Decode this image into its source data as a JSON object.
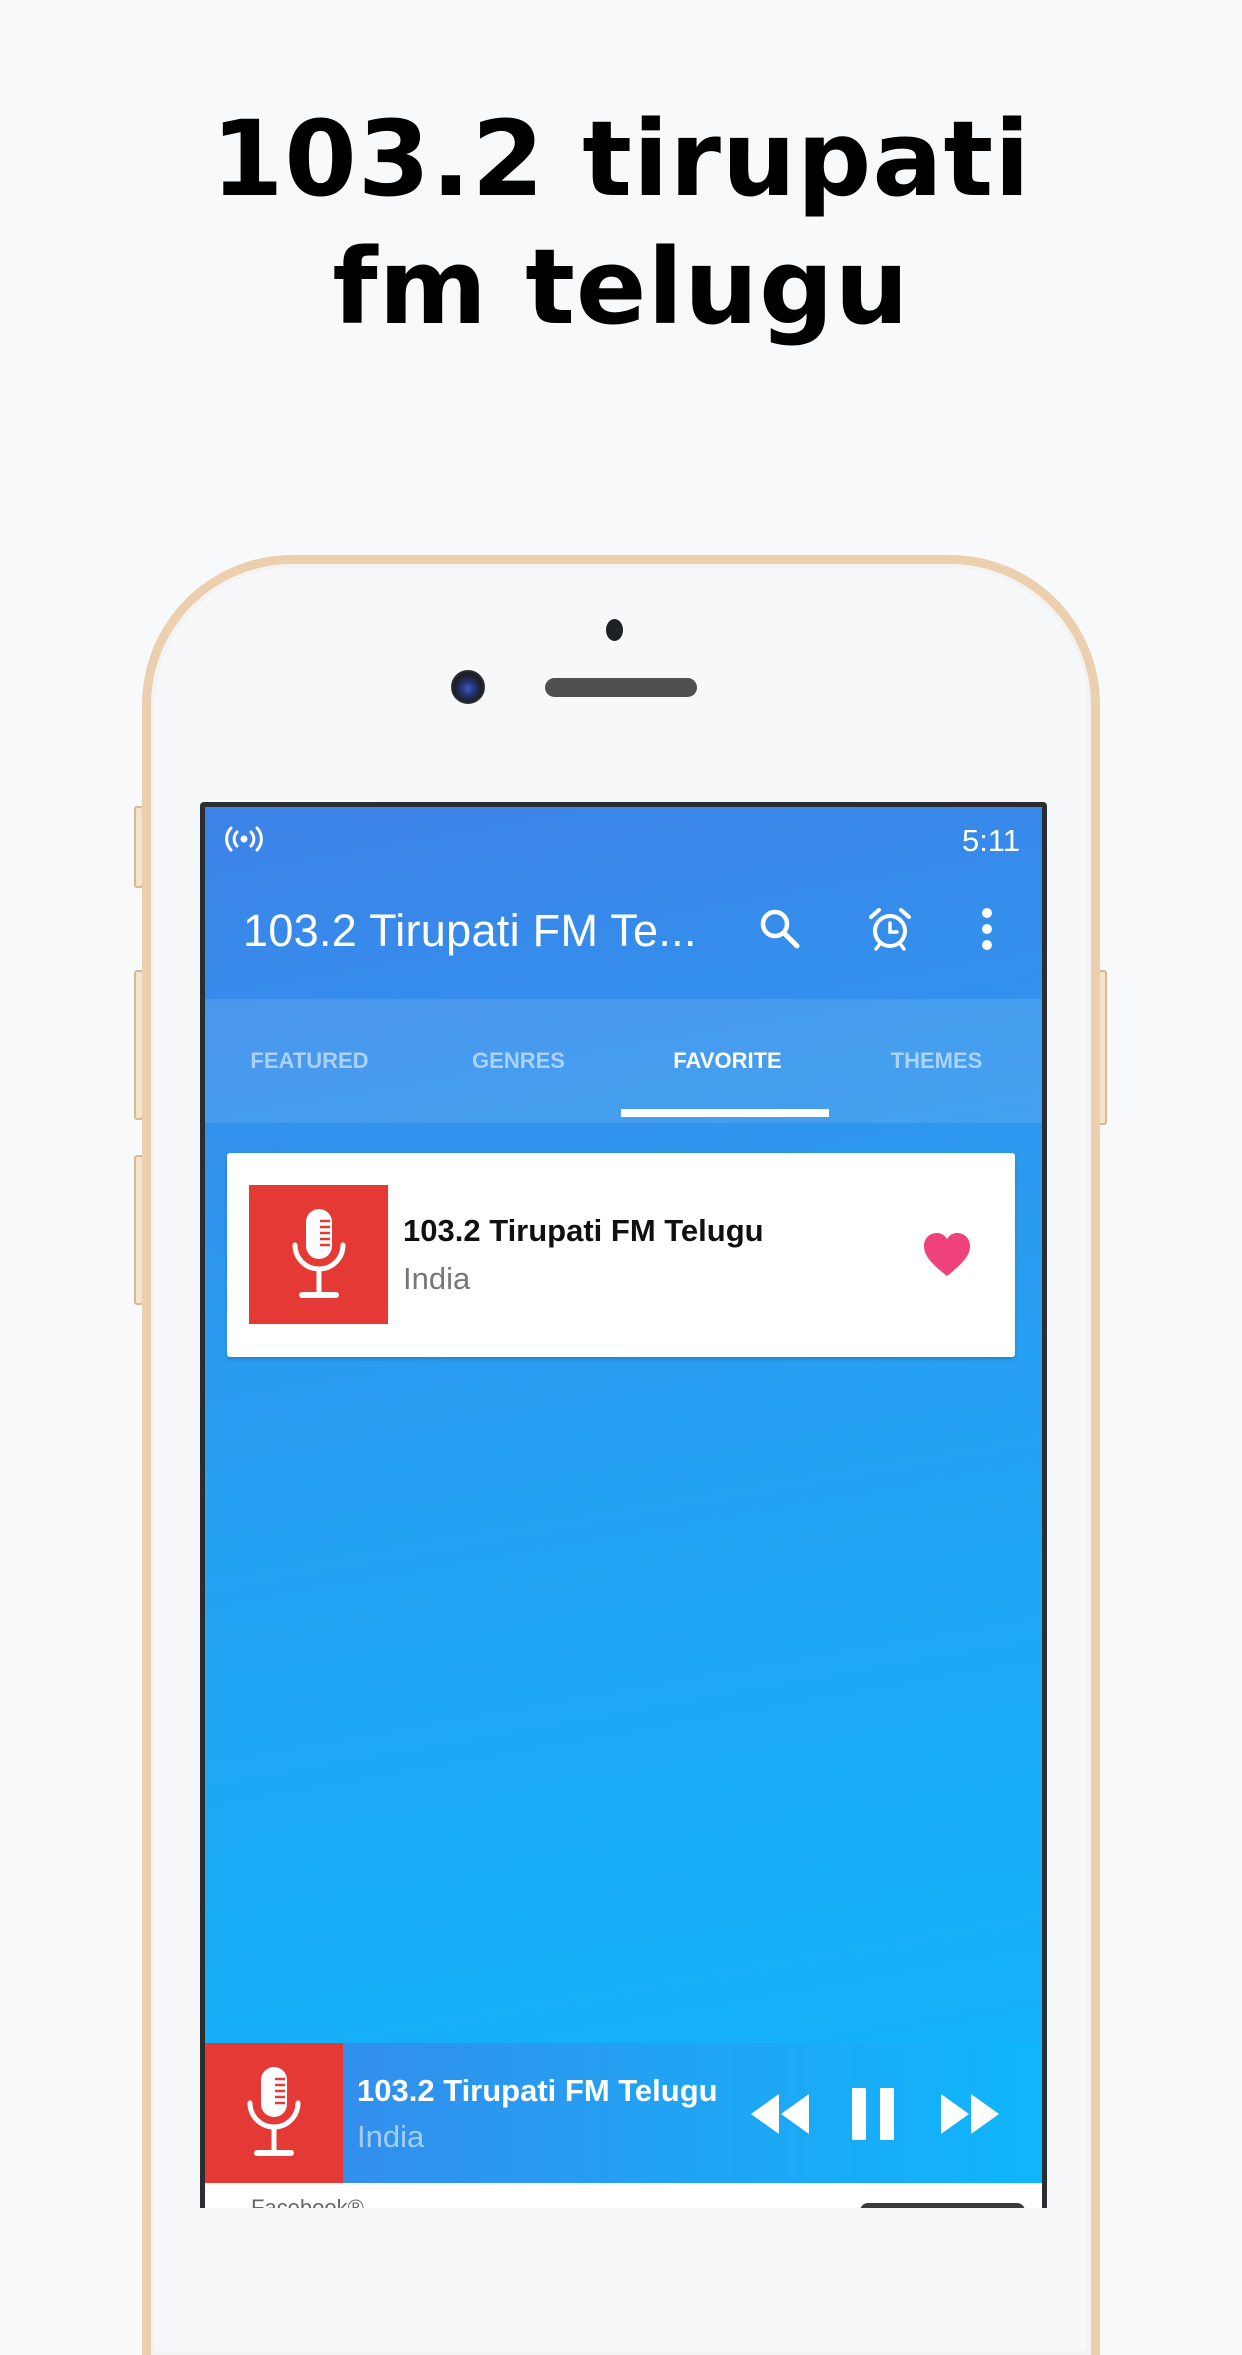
{
  "promo": {
    "title_line1": "103.2 tirupati",
    "title_line2": "fm telugu"
  },
  "status_bar": {
    "left_icon": "broadcast-icon",
    "time": "5:11"
  },
  "app_bar": {
    "title": "103.2 Tirupati FM Te...",
    "actions": [
      "search-icon",
      "alarm-clock-icon",
      "more-vert-icon"
    ]
  },
  "tabs": [
    {
      "label": "FEATURED",
      "active": false
    },
    {
      "label": "GENRES",
      "active": false
    },
    {
      "label": "FAVORITE",
      "active": true
    },
    {
      "label": "THEMES",
      "active": false
    }
  ],
  "favorites": [
    {
      "name": "103.2 Tirupati FM Telugu",
      "country": "India",
      "icon": "microphone-icon",
      "favorited": true
    }
  ],
  "player": {
    "station_name": "103.2 Tirupati FM Telugu",
    "country": "India",
    "state": "playing",
    "controls": [
      "rewind-icon",
      "pause-icon",
      "fast-forward-icon"
    ]
  },
  "ad": {
    "label": "Facebook®"
  },
  "colors": {
    "primary_blue": "#3d82e8",
    "accent_cyan": "#0eb5fb",
    "thumb_red": "#e53935",
    "heart_pink": "#f0427a",
    "phone_gold": "#eccfae"
  }
}
